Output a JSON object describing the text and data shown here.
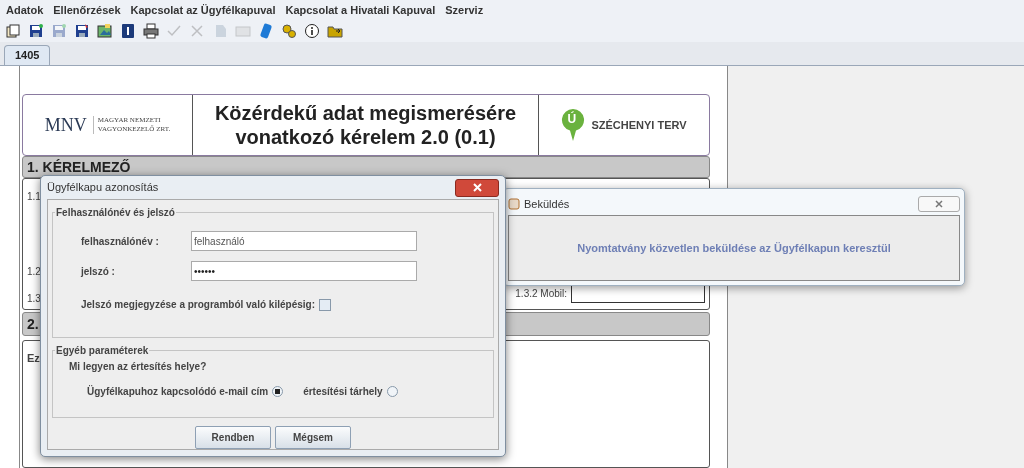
{
  "menu": [
    "Adatok",
    "Ellenőrzések",
    "Kapcsolat az Ügyfélkapuval",
    "Kapcsolat a Hivatali Kapuval",
    "Szerviz"
  ],
  "toolbar": [
    {
      "kind": "copy",
      "disabled": false
    },
    {
      "kind": "save",
      "disabled": false
    },
    {
      "kind": "save",
      "disabled": true
    },
    {
      "kind": "saveas",
      "disabled": false
    },
    {
      "kind": "image",
      "disabled": false
    },
    {
      "kind": "book",
      "disabled": false
    },
    {
      "kind": "print",
      "disabled": false
    },
    {
      "kind": "check",
      "disabled": true
    },
    {
      "kind": "cross",
      "disabled": true
    },
    {
      "kind": "stamp",
      "disabled": true
    },
    {
      "kind": "mail",
      "disabled": true
    },
    {
      "kind": "device",
      "disabled": false
    },
    {
      "kind": "gears",
      "disabled": false
    },
    {
      "kind": "info",
      "disabled": false
    },
    {
      "kind": "folder",
      "disabled": false
    }
  ],
  "tabs": [
    {
      "label": "1405",
      "selected": true
    }
  ],
  "form": {
    "logo_left": {
      "mark": "MNV",
      "line_1": "MAGYAR NEMZETI",
      "line_2": "VAGYONKEZELŐ ZRT."
    },
    "title": "Közérdekű adat megismerésére vonatkozó kérelem 2.0 (0.1)",
    "logo_right": {
      "mark": "Ú",
      "name": "SZÉCHENYI TERV"
    },
    "section_1": "1. KÉRELMEZŐ",
    "rows": [
      "1.1",
      "1.2",
      "1.3"
    ],
    "mobile_label": "1.3.2 Mobil:",
    "section_2": "2.",
    "note": "Ez"
  },
  "login_dialog": {
    "title": "Ügyfélkapu azonosítás",
    "group_1": "Felhasználónév és jelszó",
    "username_label": "felhasználónév :",
    "username_value": "felhasználó",
    "password_label": "jelszó :",
    "password_value": "••••••",
    "remember_label": "Jelszó megjegyzése a programból való kilépésig:",
    "remember_checked": false,
    "group_2": "Egyéb paraméterek",
    "question": "Mi legyen az értesítés helye?",
    "options": [
      {
        "label": "Ügyfélkapuhoz kapcsolódó e-mail cím",
        "selected": true
      },
      {
        "label": "értesítési tárhely",
        "selected": false
      }
    ],
    "buttons": [
      "Rendben",
      "Mégsem"
    ]
  },
  "send_dialog": {
    "title": "Beküldés",
    "message": "Nyomtatvány közvetlen beküldése az Ügyfélkapun keresztül"
  }
}
